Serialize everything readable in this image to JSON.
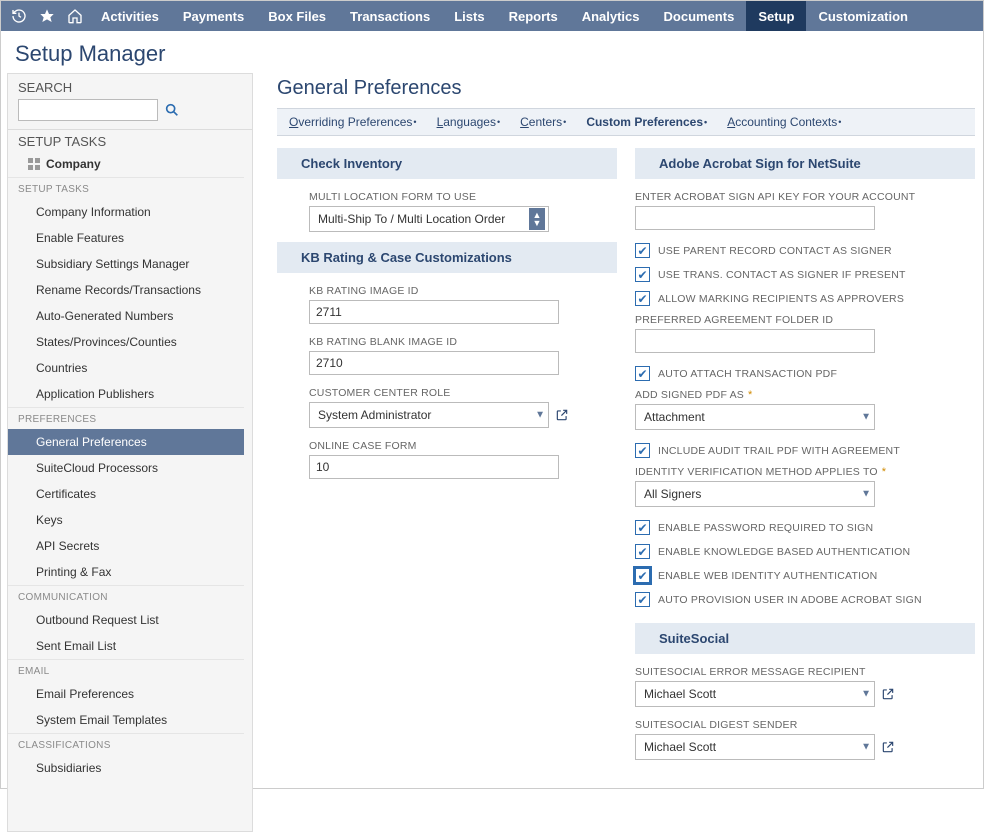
{
  "topnav": {
    "items": [
      "Activities",
      "Payments",
      "Box Files",
      "Transactions",
      "Lists",
      "Reports",
      "Analytics",
      "Documents",
      "Setup",
      "Customization"
    ],
    "active_index": 8
  },
  "page_title": "Setup Manager",
  "sidebar": {
    "search_header": "SEARCH",
    "search_value": "",
    "tasks_header": "SETUP TASKS",
    "company_label": "Company",
    "sections": [
      {
        "header": "SETUP TASKS",
        "items": [
          "Company Information",
          "Enable Features",
          "Subsidiary Settings Manager",
          "Rename Records/Transactions",
          "Auto-Generated Numbers",
          "States/Provinces/Counties",
          "Countries",
          "Application Publishers"
        ]
      },
      {
        "header": "PREFERENCES",
        "items": [
          "General Preferences",
          "SuiteCloud Processors",
          "Certificates",
          "Keys",
          "API Secrets",
          "Printing & Fax"
        ]
      },
      {
        "header": "COMMUNICATION",
        "items": [
          "Outbound Request List",
          "Sent Email List"
        ]
      },
      {
        "header": "EMAIL",
        "items": [
          "Email Preferences",
          "System Email Templates"
        ]
      },
      {
        "header": "CLASSIFICATIONS",
        "items": [
          "Subsidiaries"
        ]
      }
    ],
    "active_section": 1,
    "active_item": 0
  },
  "content": {
    "title": "General Preferences",
    "subtabs": [
      {
        "u": "O",
        "rest": "verriding Preferences"
      },
      {
        "u": "L",
        "rest": "anguages"
      },
      {
        "u": "C",
        "rest": "enters"
      },
      {
        "u": "",
        "rest": "Custom Preferences"
      },
      {
        "u": "A",
        "rest": "ccounting Contexts"
      }
    ],
    "active_subtab": 3
  },
  "left_col": {
    "section1_header": "Check Inventory",
    "multi_location_label": "MULTI LOCATION FORM TO USE",
    "multi_location_value": "Multi-Ship To / Multi Location Order",
    "section2_header": "KB Rating & Case Customizations",
    "kb_rating_label": "KB RATING IMAGE ID",
    "kb_rating_value": "2711",
    "kb_rating_blank_label": "KB RATING BLANK IMAGE ID",
    "kb_rating_blank_value": "2710",
    "customer_center_label": "CUSTOMER CENTER ROLE",
    "customer_center_value": "System Administrator",
    "online_case_label": "ONLINE CASE FORM",
    "online_case_value": "10"
  },
  "right_col": {
    "section1_header": "Adobe Acrobat Sign for NetSuite",
    "api_key_label": "ENTER ACROBAT SIGN API KEY FOR YOUR ACCOUNT",
    "api_key_value": "",
    "cb_parent_signer": "USE PARENT RECORD CONTACT AS SIGNER",
    "cb_trans_contact": "USE TRANS. CONTACT AS SIGNER IF PRESENT",
    "cb_allow_approvers": "ALLOW MARKING RECIPIENTS AS APPROVERS",
    "pref_folder_label": "PREFERRED AGREEMENT FOLDER ID",
    "pref_folder_value": "",
    "cb_auto_attach": "AUTO ATTACH TRANSACTION PDF",
    "add_signed_label": "ADD SIGNED PDF AS",
    "add_signed_value": "Attachment",
    "cb_audit_trail": "INCLUDE AUDIT TRAIL PDF WITH AGREEMENT",
    "identity_label": "IDENTITY VERIFICATION METHOD APPLIES TO",
    "identity_value": "All Signers",
    "cb_pwd_required": "ENABLE PASSWORD REQUIRED TO SIGN",
    "cb_kba": "ENABLE KNOWLEDGE BASED AUTHENTICATION",
    "cb_web_identity": "ENABLE WEB IDENTITY AUTHENTICATION",
    "cb_auto_provision": "AUTO PROVISION USER IN ADOBE ACROBAT SIGN",
    "section2_header": "SuiteSocial",
    "ss_error_label": "SUITESOCIAL ERROR MESSAGE RECIPIENT",
    "ss_error_value": "Michael Scott",
    "ss_digest_label": "SUITESOCIAL DIGEST SENDER",
    "ss_digest_value": "Michael Scott"
  }
}
